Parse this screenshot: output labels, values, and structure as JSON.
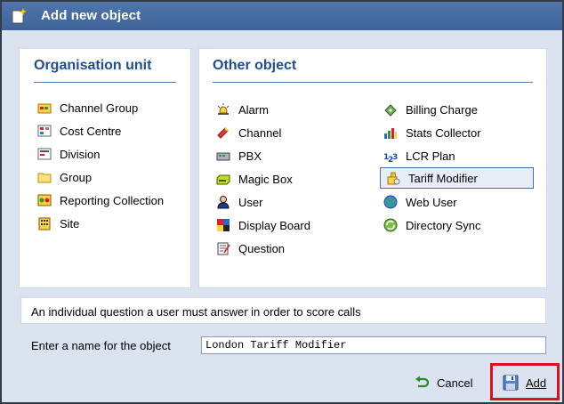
{
  "window": {
    "title": "Add new object"
  },
  "organisation_unit": {
    "heading": "Organisation unit",
    "items": [
      {
        "label": "Channel Group",
        "icon": "channel-group-icon"
      },
      {
        "label": "Cost Centre",
        "icon": "cost-centre-icon"
      },
      {
        "label": "Division",
        "icon": "division-icon"
      },
      {
        "label": "Group",
        "icon": "folder-icon"
      },
      {
        "label": "Reporting Collection",
        "icon": "reporting-collection-icon"
      },
      {
        "label": "Site",
        "icon": "building-icon"
      }
    ]
  },
  "other_object": {
    "heading": "Other object",
    "left_items": [
      {
        "label": "Alarm",
        "icon": "alarm-icon"
      },
      {
        "label": "Channel",
        "icon": "channel-icon"
      },
      {
        "label": "PBX",
        "icon": "pbx-icon"
      },
      {
        "label": "Magic Box",
        "icon": "magic-box-icon"
      },
      {
        "label": "User",
        "icon": "user-icon"
      },
      {
        "label": "Display Board",
        "icon": "display-board-icon"
      },
      {
        "label": "Question",
        "icon": "question-icon"
      }
    ],
    "right_items": [
      {
        "label": "Billing Charge",
        "icon": "billing-charge-icon"
      },
      {
        "label": "Stats Collector",
        "icon": "stats-collector-icon"
      },
      {
        "label": "LCR Plan",
        "icon": "lcr-plan-icon"
      },
      {
        "label": "Tariff Modifier",
        "icon": "tariff-modifier-icon",
        "selected": true
      },
      {
        "label": "Web User",
        "icon": "web-user-icon"
      },
      {
        "label": "Directory Sync",
        "icon": "directory-sync-icon"
      }
    ]
  },
  "description": "An individual question a user must answer in order to score calls",
  "name_field": {
    "label": "Enter a name for the object",
    "value": "London Tariff Modifier"
  },
  "buttons": {
    "cancel": "Cancel",
    "add": "Add"
  },
  "colors": {
    "titlebar": "#3d6399",
    "heading": "#1e4f92",
    "dialog_bg": "#dbe3f1",
    "highlight": "#e0101a"
  }
}
